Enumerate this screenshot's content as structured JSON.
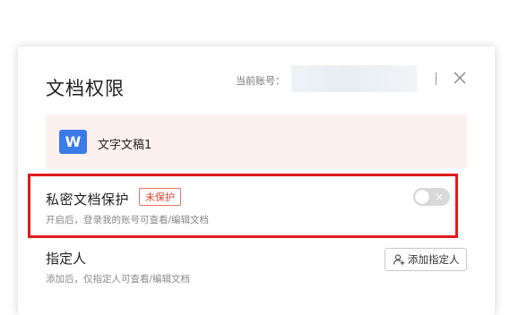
{
  "dialog": {
    "title": "文档权限",
    "account_label": "当前账号：",
    "close_icon": "close-icon"
  },
  "file": {
    "icon_letter": "W",
    "icon_color": "#3a7be8",
    "name": "文字文稿1"
  },
  "private_protection": {
    "title": "私密文档保护",
    "status_badge": "未保护",
    "description": "开启后，登录我的账号可查看/编辑文档",
    "toggle_state": "off",
    "toggle_symbol": "×"
  },
  "designated": {
    "title": "指定人",
    "description": "添加后，仅指定人可查看/编辑文档",
    "add_button_label": "添加指定人",
    "add_button_icon": "add-user-icon"
  },
  "colors": {
    "highlight_border": "#e01b1b",
    "badge": "#e0462d",
    "file_row_bg": "#fdf1ef"
  }
}
